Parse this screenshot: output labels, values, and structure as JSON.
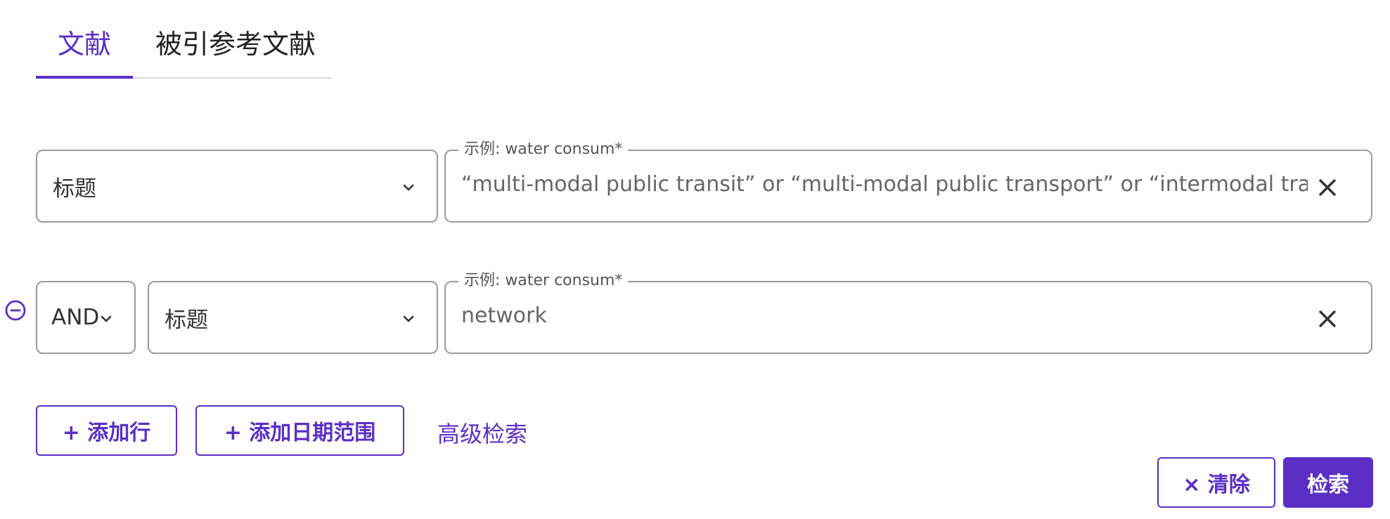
{
  "tabs": [
    {
      "label": "文献",
      "active": true
    },
    {
      "label": "被引参考文献",
      "active": false
    }
  ],
  "rows": [
    {
      "field": "标题",
      "placeholder": "示例: water consum*",
      "value": "“multi-modal public transit” or “multi-modal public transport” or “intermodal transit syst"
    },
    {
      "operator": "AND",
      "field": "标题",
      "placeholder": "示例: water consum*",
      "value": "network"
    }
  ],
  "actions": {
    "add_row": "+ 添加行",
    "add_date_range": "+ 添加日期范围",
    "advanced_search": "高级检索",
    "clear": "× 清除",
    "search": "检索"
  },
  "colors": {
    "accent": "#5b2ec5",
    "border": "#9a9a9a"
  },
  "icons": {
    "chevron": "chevron-down-icon",
    "clear": "close-icon",
    "remove_row": "minus-circle-icon"
  }
}
